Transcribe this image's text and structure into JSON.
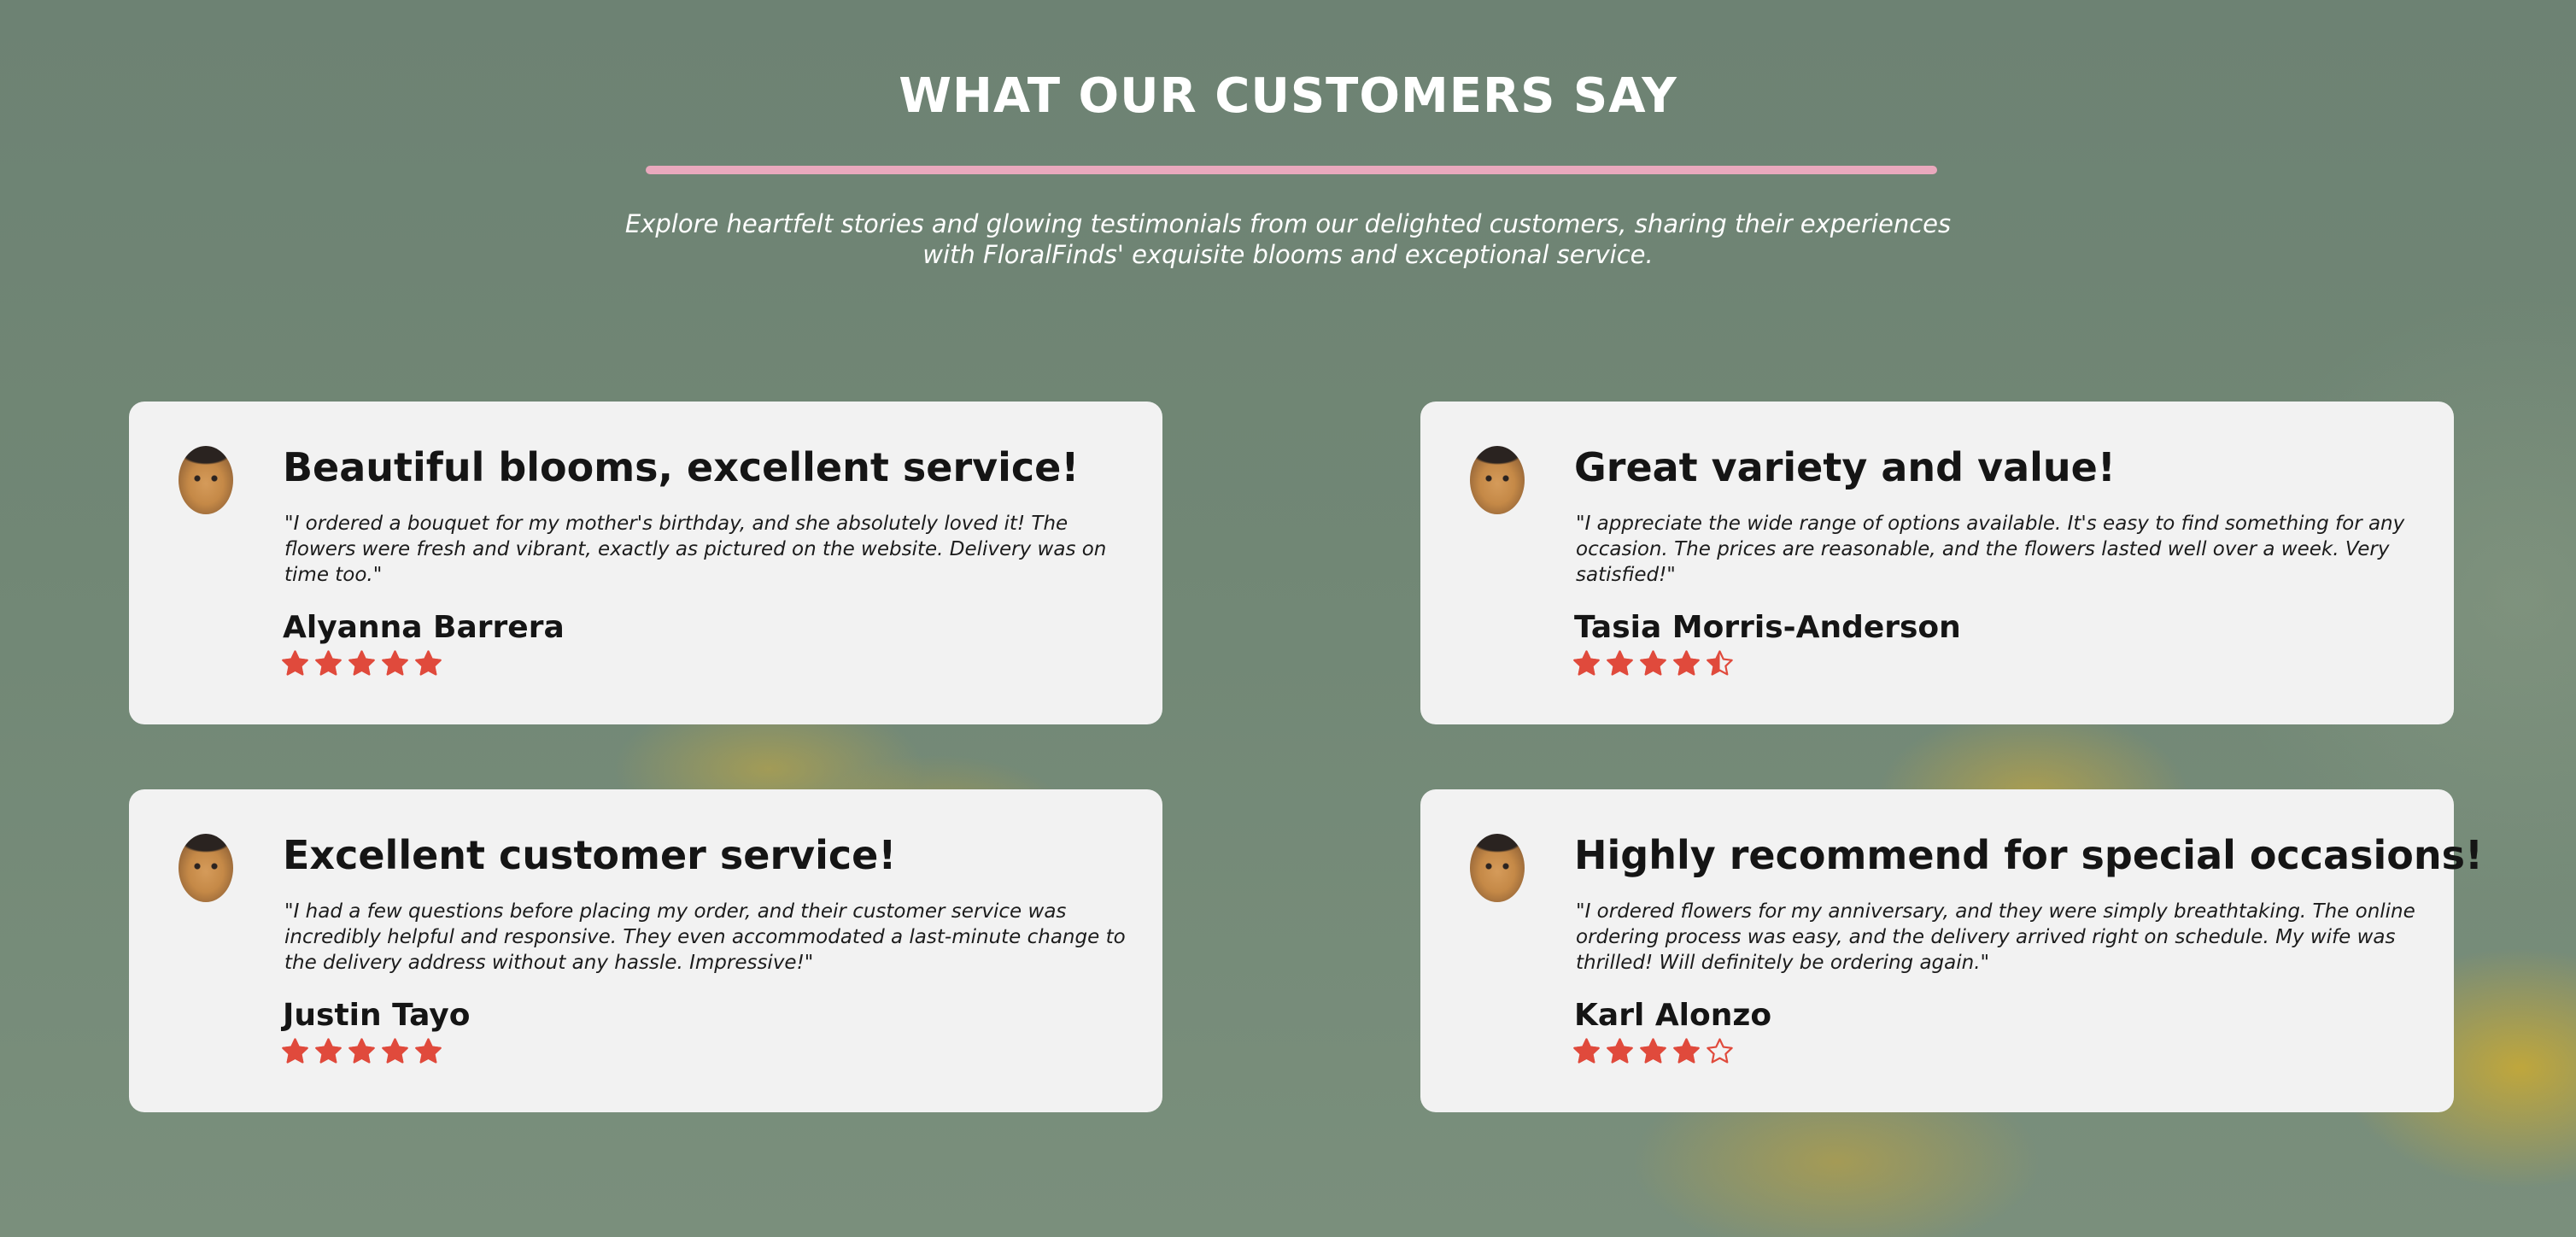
{
  "section": {
    "title": "WHAT OUR CUSTOMERS SAY",
    "subtitle": "Explore heartfelt stories and glowing testimonials from our delighted customers, sharing their experiences with FloralFinds' exquisite blooms and exceptional service."
  },
  "colors": {
    "accent_divider": "#e9a9bd",
    "star": "#e04a3c",
    "card_bg": "#f2f2f2"
  },
  "testimonials": [
    {
      "title": "Beautiful blooms, excellent service!",
      "quote": "\"I ordered a bouquet for my mother's birthday, and she absolutely loved it! The flowers were fresh and vibrant, exactly as pictured on the website. Delivery was on time too.\"",
      "author": "Alyanna Barrera",
      "rating": 5
    },
    {
      "title": "Great variety and value!",
      "quote": "\"I appreciate the wide range of options available. It's easy to find something for any occasion. The prices are reasonable, and the flowers lasted well over a week. Very satisfied!\"",
      "author": "Tasia Morris-Anderson",
      "rating": 4.5
    },
    {
      "title": "Excellent customer service!",
      "quote": "\"I had a few questions before placing my order, and their customer service was incredibly helpful and responsive. They even accommodated a last-minute change to the delivery address without any hassle. Impressive!\"",
      "author": "Justin Tayo",
      "rating": 5
    },
    {
      "title": "Highly recommend for special occasions!",
      "quote": "\"I ordered flowers for my anniversary, and they were simply breathtaking. The online ordering process was easy, and the delivery arrived right on schedule. My wife was thrilled! Will definitely be ordering again.\"",
      "author": "Karl Alonzo",
      "rating": 4
    }
  ]
}
